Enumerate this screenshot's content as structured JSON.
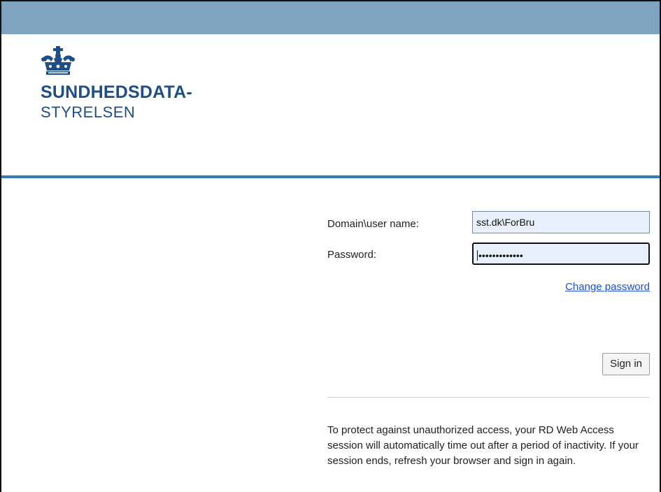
{
  "brand": {
    "line1": "SUNDHEDSDATA-",
    "line2": "STYRELSEN",
    "color": "#1e4e88"
  },
  "colors": {
    "topbar": "#7ea4bf",
    "rule": "#2f7fb7",
    "link": "#1a4fd8"
  },
  "login": {
    "username_label": "Domain\\user name:",
    "username_value": "sst.dk\\ForBru",
    "password_label": "Password:",
    "password_mask": "•••••••••••••",
    "change_password": "Change password",
    "sign_in": "Sign in"
  },
  "notice": "To protect against unauthorized access, your RD Web Access session will automatically time out after a period of inactivity. If your session ends, refresh your browser and sign in again."
}
